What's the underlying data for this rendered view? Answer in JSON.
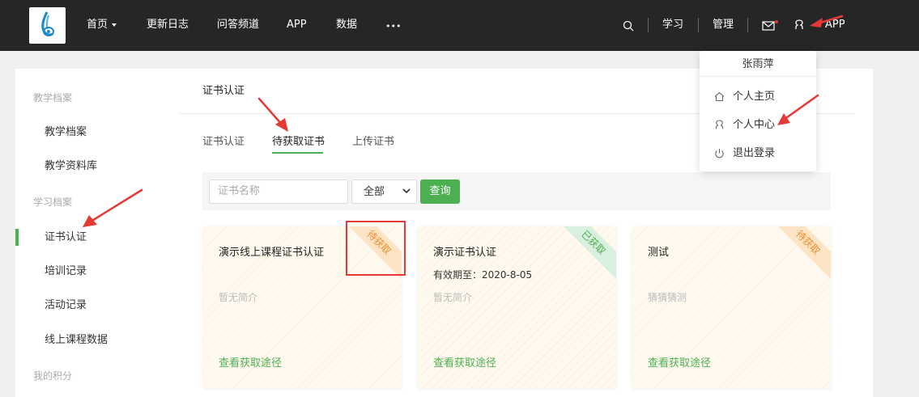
{
  "header": {
    "nav": [
      {
        "label": "首页"
      },
      {
        "label": "更新日志"
      },
      {
        "label": "问答频道"
      },
      {
        "label": "APP"
      },
      {
        "label": "数据"
      },
      {
        "label": "•••"
      }
    ],
    "right": {
      "study": "学习",
      "manage": "管理",
      "app": "APP"
    }
  },
  "user_menu": {
    "username": "张雨萍",
    "items": [
      {
        "label": "个人主页",
        "icon": "home-icon"
      },
      {
        "label": "个人中心",
        "icon": "user-icon"
      },
      {
        "label": "退出登录",
        "icon": "power-icon"
      }
    ]
  },
  "sidebar": {
    "groups": [
      {
        "title": "教学档案",
        "items": [
          {
            "label": "教学档案"
          },
          {
            "label": "教学资料库"
          }
        ]
      },
      {
        "title": "学习档案",
        "items": [
          {
            "label": "证书认证"
          },
          {
            "label": "培训记录"
          },
          {
            "label": "活动记录"
          },
          {
            "label": "线上课程数据"
          }
        ]
      },
      {
        "title": "我的积分",
        "items": []
      }
    ],
    "active": "证书认证"
  },
  "main": {
    "title": "证书认证",
    "tabs": [
      {
        "label": "证书认证"
      },
      {
        "label": "待获取证书"
      },
      {
        "label": "上传证书"
      }
    ],
    "active_tab": "待获取证书",
    "filter": {
      "placeholder": "证书名称",
      "select_value": "全部",
      "query_label": "查询"
    },
    "cards": [
      {
        "title": "演示线上课程证书认证",
        "validity": "",
        "desc": "暂无简介",
        "status": "待获取",
        "link": "查看获取途径"
      },
      {
        "title": "演示证书认证",
        "validity": "有效期至：2020-8-05",
        "desc": "暂无简介",
        "status": "已获取",
        "link": "查看获取途径"
      },
      {
        "title": "测试",
        "validity": "",
        "desc": "猜猜猜测",
        "status": "待获取",
        "link": "查看获取途径"
      }
    ]
  },
  "colors": {
    "accent": "#4caf50",
    "topbar": "#262626",
    "annotation": "#e53935"
  }
}
